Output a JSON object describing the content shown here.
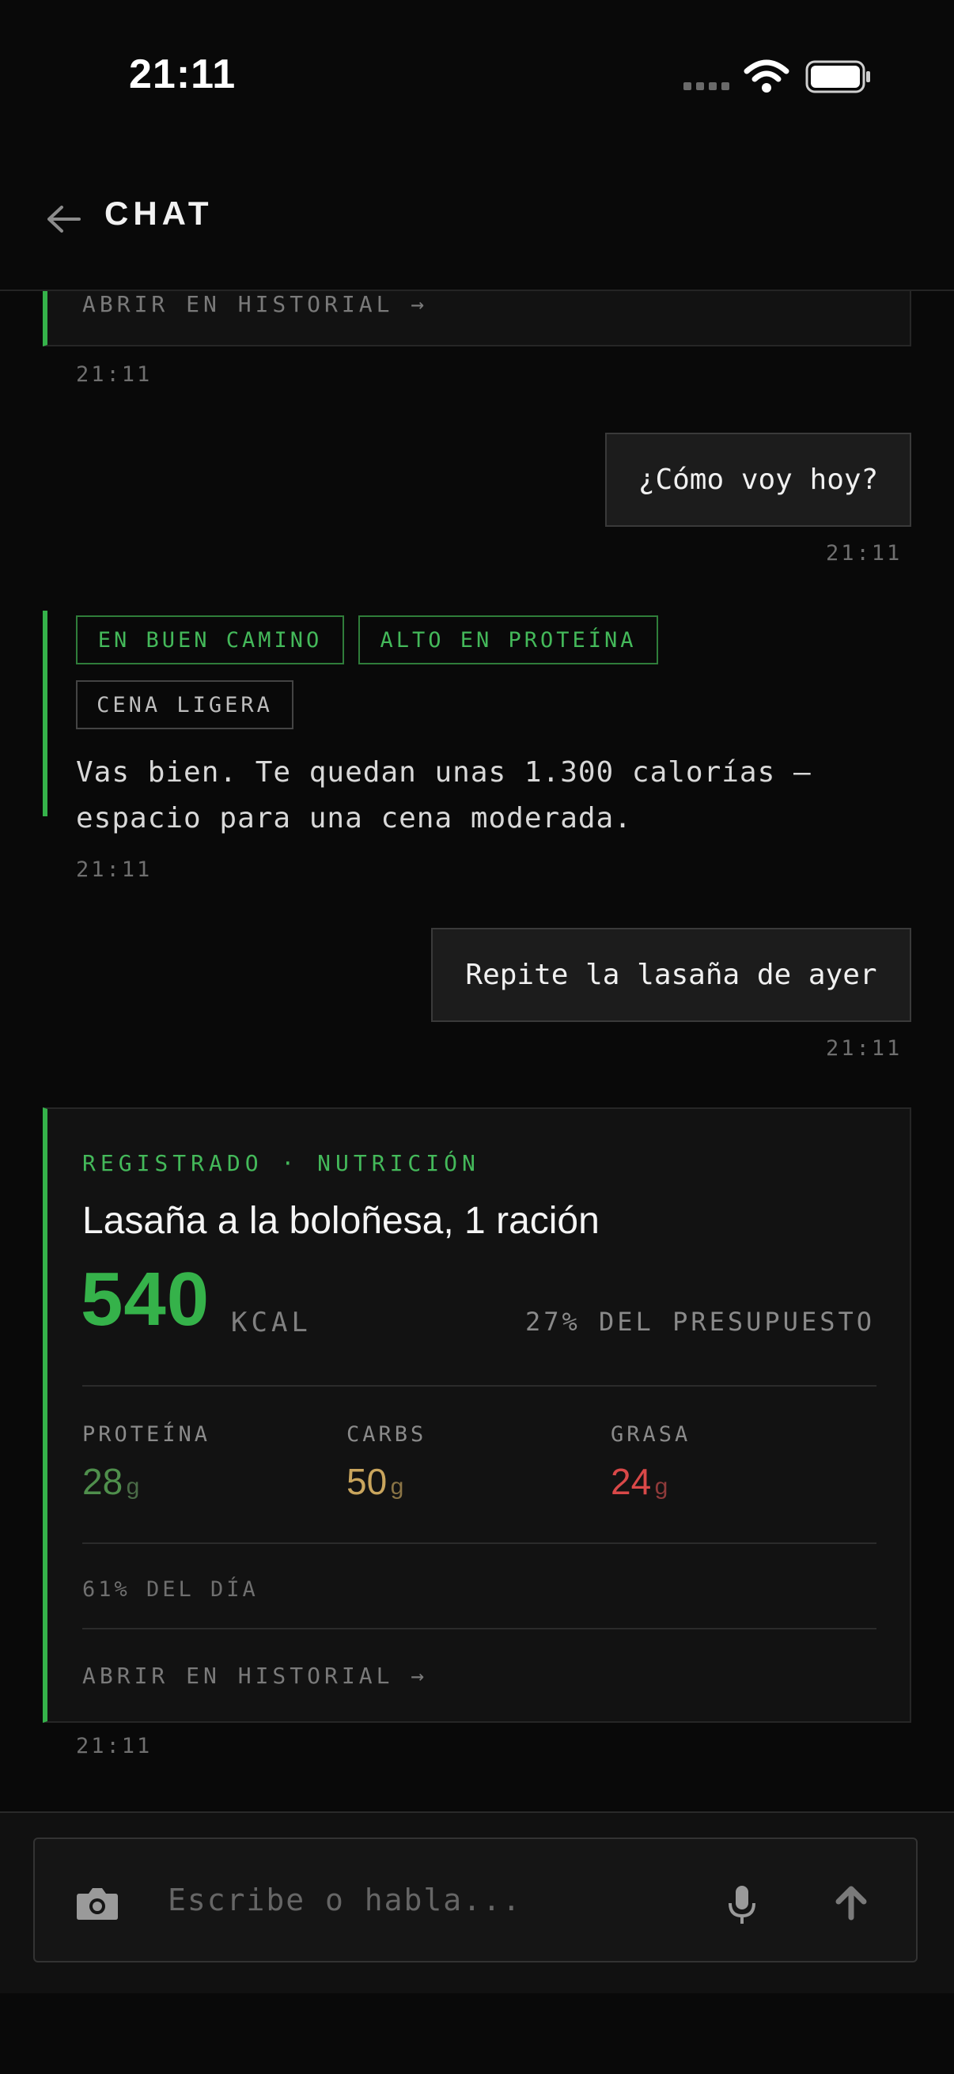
{
  "status_bar": {
    "time": "21:11"
  },
  "header": {
    "title": "CHAT"
  },
  "messages": {
    "top_card_link": "ABRIR EN HISTORIAL →",
    "top_card_time": "21:11",
    "user1": {
      "text": "¿Cómo voy hoy?",
      "time": "21:11"
    },
    "assistant1": {
      "tags": [
        "EN BUEN CAMINO",
        "ALTO EN PROTEÍNA",
        "CENA LIGERA"
      ],
      "text_line1": "Vas bien. Te quedan unas 1.300 calorías —",
      "text_line2": "espacio para una cena moderada.",
      "time": "21:11"
    },
    "user2": {
      "text": "Repite la lasaña de ayer",
      "time": "21:11"
    },
    "nutrition_card": {
      "kicker": "REGISTRADO · NUTRICIÓN",
      "food": "Lasaña a la boloñesa, 1 ración",
      "kcal_value": "540",
      "kcal_unit": "KCAL",
      "budget": "27% DEL PRESUPUESTO",
      "macros": [
        {
          "label": "PROTEÍNA",
          "value": "28",
          "unit": "g",
          "color": "#4f8f4c"
        },
        {
          "label": "CARBS",
          "value": "50",
          "unit": "g",
          "color": "#c9a55d"
        },
        {
          "label": "GRASA",
          "value": "24",
          "unit": "g",
          "color": "#d94848"
        }
      ],
      "day_percent": "61% DEL DÍA",
      "link": "ABRIR EN HISTORIAL →",
      "time": "21:11"
    }
  },
  "input": {
    "placeholder": "Escribe o habla...",
    "icons": [
      "camera-icon",
      "microphone-icon",
      "send-arrow-icon"
    ]
  },
  "colors": {
    "accent": "#35b24a",
    "background": "#090909"
  }
}
